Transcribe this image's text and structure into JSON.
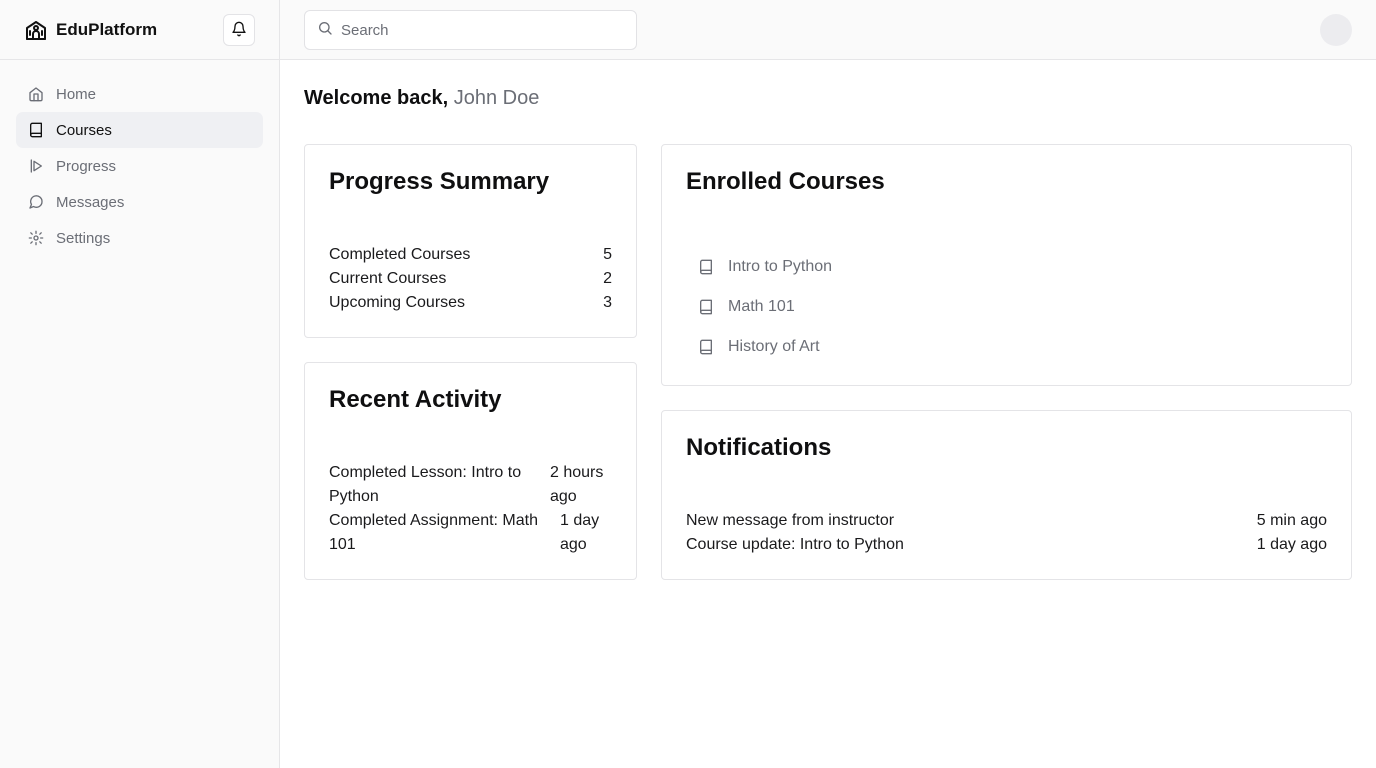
{
  "app": {
    "name": "EduPlatform"
  },
  "sidebar": {
    "items": [
      {
        "label": "Home",
        "icon": "home-icon"
      },
      {
        "label": "Courses",
        "icon": "book-icon",
        "active": true
      },
      {
        "label": "Progress",
        "icon": "play-icon"
      },
      {
        "label": "Messages",
        "icon": "message-icon"
      },
      {
        "label": "Settings",
        "icon": "gear-icon"
      }
    ]
  },
  "search": {
    "placeholder": "Search"
  },
  "welcome": {
    "prefix": "Welcome back,",
    "name": "John Doe"
  },
  "progress_summary": {
    "title": "Progress Summary",
    "rows": [
      {
        "label": "Completed Courses",
        "value": "5"
      },
      {
        "label": "Current Courses",
        "value": "2"
      },
      {
        "label": "Upcoming Courses",
        "value": "3"
      }
    ]
  },
  "recent_activity": {
    "title": "Recent Activity",
    "rows": [
      {
        "text": "Completed Lesson: Intro to Python",
        "time": "2 hours ago"
      },
      {
        "text": "Completed Assignment: Math 101",
        "time": "1 day ago"
      }
    ]
  },
  "enrolled_courses": {
    "title": "Enrolled Courses",
    "items": [
      "Intro to Python",
      "Math 101",
      "History of Art"
    ]
  },
  "notifications": {
    "title": "Notifications",
    "rows": [
      {
        "text": "New message from instructor",
        "time": "5 min ago"
      },
      {
        "text": "Course update: Intro to Python",
        "time": "1 day ago"
      }
    ]
  },
  "colors": {
    "muted": "#6b6e76",
    "active_bg": "#eff0f3",
    "border": "#e4e4e7"
  }
}
